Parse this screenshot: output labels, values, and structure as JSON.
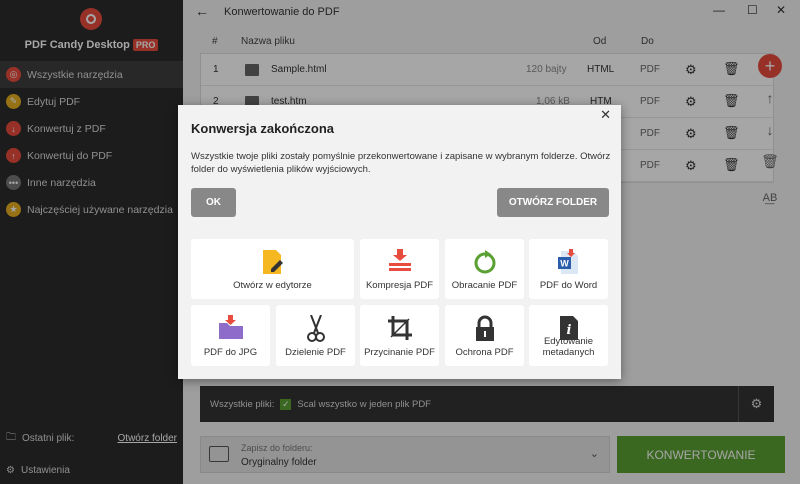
{
  "app": {
    "brand": "PDF Candy Desktop",
    "pro_badge": "PRO"
  },
  "sidebar": {
    "items": [
      {
        "label": "Wszystkie narzędzia",
        "active": true,
        "color": "#e84c3d"
      },
      {
        "label": "Edytuj PDF",
        "color": "#e6b021"
      },
      {
        "label": "Konwertuj z PDF",
        "color": "#e84c3d"
      },
      {
        "label": "Konwertuj do PDF",
        "color": "#e84c3d"
      },
      {
        "label": "Inne narzędzia",
        "color": "#777777"
      },
      {
        "label": "Najczęściej używane narzędzia",
        "color": "#e6b021"
      }
    ],
    "recent_label": "Ostatni plik:",
    "recent_link": "Otwórz folder",
    "settings": "Ustawienia"
  },
  "header": {
    "title": "Konwertowanie do PDF"
  },
  "table": {
    "columns": {
      "num": "#",
      "name": "Nazwa pliku",
      "from": "Od",
      "to": "Do"
    },
    "rows": [
      {
        "num": "1",
        "name": "Sample.html",
        "size": "120 bajty",
        "from": "HTML",
        "to": "PDF"
      },
      {
        "num": "2",
        "name": "test.htm",
        "size": "1,06 kB",
        "from": "HTM",
        "to": "PDF"
      },
      {
        "num": "",
        "name": "",
        "size": "",
        "from": "",
        "to": "PDF"
      },
      {
        "num": "",
        "name": "",
        "size": "",
        "from": "",
        "to": "PDF"
      }
    ]
  },
  "options": {
    "all_files": "Wszystkie pliki:",
    "merge": "Scal wszystko w jeden plik PDF"
  },
  "save": {
    "label": "Zapisz do folderu:",
    "value": "Oryginalny folder"
  },
  "convert_button": "KONWERTOWANIE",
  "dialog": {
    "title": "Konwersja zakończona",
    "message": "Wszystkie twoje pliki zostały pomyślnie przekonwertowane i zapisane w wybranym folderze. Otwórz folder do wyświetlenia plików wyjściowych.",
    "ok": "OK",
    "open_folder": "OTWÓRZ FOLDER",
    "tiles": [
      "Otwórz w edytorze",
      "Kompresja PDF",
      "Obracanie PDF",
      "PDF do Word",
      "PDF do JPG",
      "Dzielenie PDF",
      "Przycinanie PDF",
      "Ochrona PDF",
      "Edytowanie metadanych"
    ]
  },
  "colors": {
    "accent": "#e84c3d",
    "success": "#5aa032"
  }
}
